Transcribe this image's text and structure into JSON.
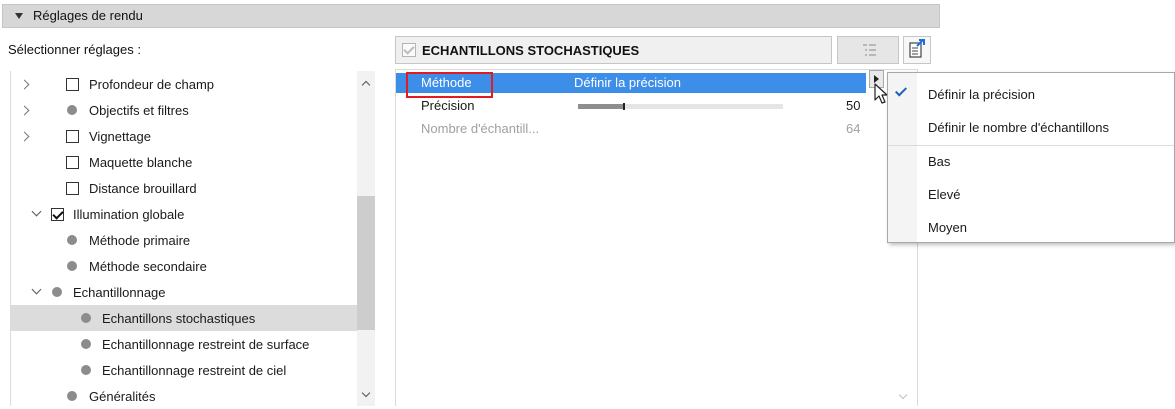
{
  "section_header": {
    "title": "Réglages de rendu"
  },
  "tree_panel": {
    "label": "Sélectionner réglages :",
    "items": [
      {
        "label": "Profondeur de champ",
        "type": "checkbox",
        "expander": "collapsed",
        "checked": false
      },
      {
        "label": "Objectifs et filtres",
        "type": "dot",
        "expander": "collapsed"
      },
      {
        "label": "Vignettage",
        "type": "checkbox",
        "expander": "collapsed",
        "checked": false
      },
      {
        "label": "Maquette blanche",
        "type": "checkbox",
        "expander": "none",
        "checked": false
      },
      {
        "label": "Distance brouillard",
        "type": "checkbox",
        "expander": "none",
        "checked": false
      },
      {
        "label": "Illumination globale",
        "type": "checkbox",
        "expander": "expanded",
        "checked": true
      },
      {
        "label": "Méthode primaire",
        "type": "dot",
        "expander": "none"
      },
      {
        "label": "Méthode secondaire",
        "type": "dot",
        "expander": "none"
      },
      {
        "label": "Echantillonnage",
        "type": "dot",
        "expander": "expanded"
      },
      {
        "label": "Echantillons stochastiques",
        "type": "dot",
        "expander": "none",
        "selected": true
      },
      {
        "label": "Echantillonnage  restreint  de surface",
        "type": "dot",
        "expander": "none"
      },
      {
        "label": "Echantillonnage restreint  de ciel",
        "type": "dot",
        "expander": "none"
      },
      {
        "label": "Généralités",
        "type": "dot",
        "expander": "none"
      }
    ]
  },
  "settings_panel": {
    "title": "ECHANTILLONS STOCHASTIQUES",
    "rows": [
      {
        "label": "Méthode",
        "value": "Définir la précision",
        "highlighted": true
      },
      {
        "label": "Précision",
        "slider_fraction": 0.22,
        "number": "50"
      },
      {
        "label": "Nombre d'échantill...",
        "number": "64",
        "disabled": true
      }
    ]
  },
  "dropdown": {
    "options": [
      {
        "label": "Définir la précision",
        "checked": true
      },
      {
        "label": "Définir le nombre d'échantillons",
        "checked": false
      },
      {
        "label": "Bas",
        "checked": false
      },
      {
        "label": "Elevé",
        "checked": false
      },
      {
        "label": "Moyen",
        "checked": false
      }
    ]
  },
  "colors": {
    "highlight": "#3c8ee8",
    "annotation_box": "#e01b24",
    "header_bg": "#d7d7d7",
    "selected_tree_row": "#dcdcdc"
  }
}
